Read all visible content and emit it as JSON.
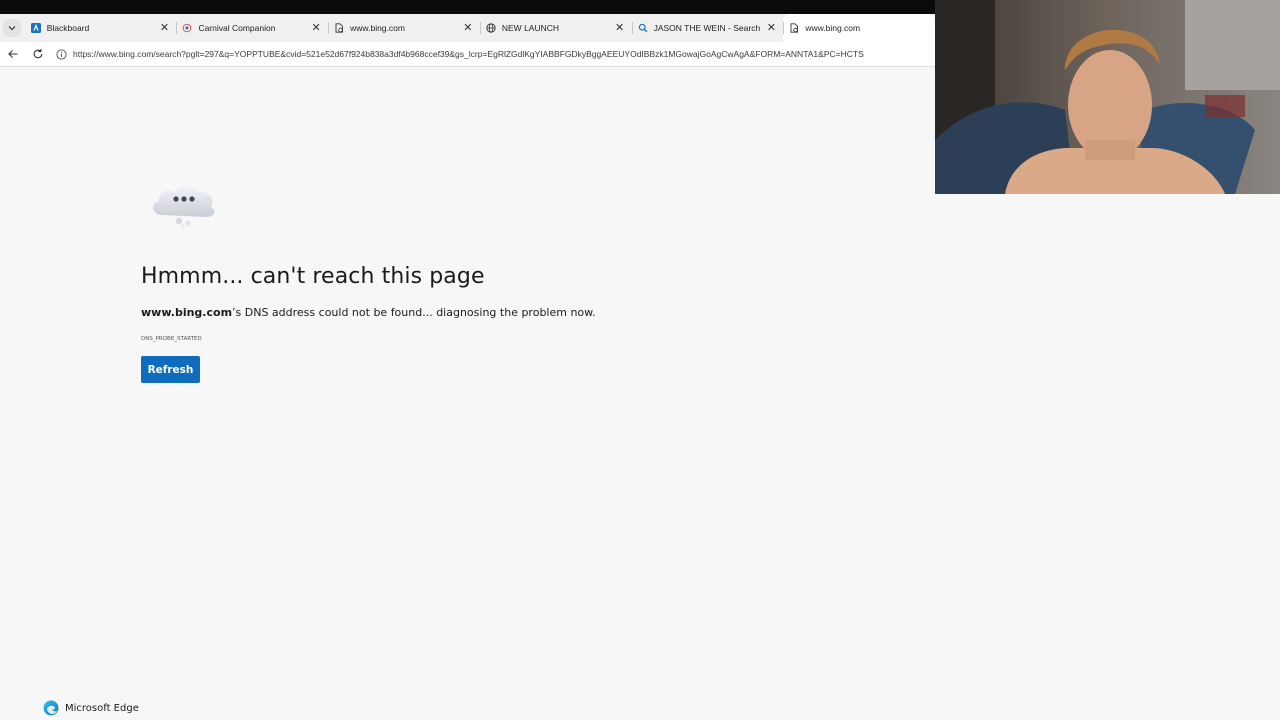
{
  "tabs": [
    {
      "label": "Blackboard",
      "icon": "blackboard-icon",
      "active": false
    },
    {
      "label": "Carnival Companion",
      "icon": "carnival-icon",
      "active": false
    },
    {
      "label": "www.bing.com",
      "icon": "broken-page-icon",
      "active": false
    },
    {
      "label": "NEW LAUNCH",
      "icon": "globe-icon",
      "active": false
    },
    {
      "label": "JASON THE WEIN - Search",
      "icon": "search-icon",
      "active": false
    },
    {
      "label": "www.bing.com",
      "icon": "broken-page-icon",
      "active": true
    }
  ],
  "address": {
    "url": "https://www.bing.com/search?pglt=297&q=YOPPTUBE&cvid=521e52d67f924b838a3df4b968ccef39&gs_lcrp=EgRlZGdlKgYIABBFGDkyBggAEEUYOdIBBzk1MGowajGoAgCwAgA&FORM=ANNTA1&PC=HCTS"
  },
  "error": {
    "title": "Hmmm... can't reach this page",
    "host": "www.bing.com",
    "description_rest": "’s DNS address could not be found... diagnosing the problem now.",
    "code": "DNS_PROBE_STARTED",
    "refresh_label": "Refresh"
  },
  "footer": {
    "brand": "Microsoft Edge"
  },
  "colors": {
    "accent": "#0f6cbd",
    "page_bg": "#f7f7f7",
    "topbar": "#0b0b0b"
  }
}
